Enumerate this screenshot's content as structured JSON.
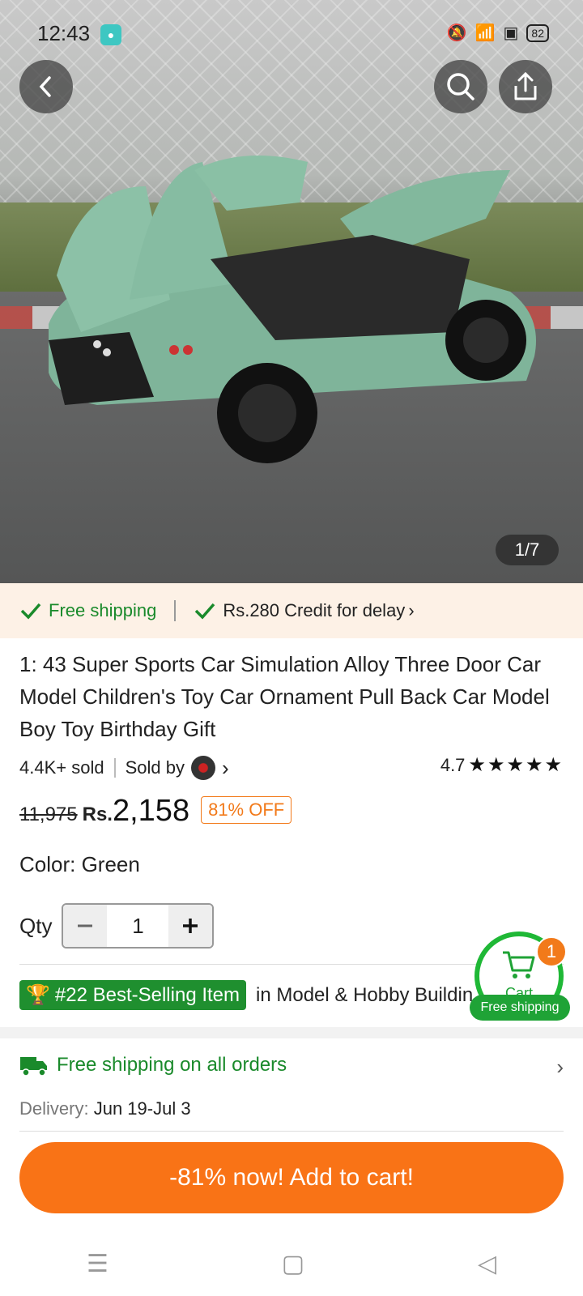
{
  "status_bar": {
    "time": "12:43",
    "battery": "82"
  },
  "hero": {
    "image_counter": "1/7"
  },
  "shipping_banner": {
    "free_shipping": "Free shipping",
    "credit": "Rs.280 Credit for delay"
  },
  "product": {
    "title": "1: 43 Super Sports Car Simulation Alloy Three Door Car Model Children's Toy Car Ornament Pull Back Car Model Boy Toy Birthday Gift",
    "sold": "4.4K+ sold",
    "sold_by": "Sold by",
    "rating": "4.7",
    "old_price": "11,975",
    "currency": "Rs.",
    "price": "2,158",
    "discount": "81% OFF",
    "color": "Color: Green",
    "qty_label": "Qty",
    "qty_value": "1"
  },
  "best_selling": {
    "badge": "#22 Best-Selling Item",
    "category": "in Model & Hobby Buildin"
  },
  "cart": {
    "label": "Cart",
    "count": "1",
    "free_shipping": "Free shipping"
  },
  "shipping_info": {
    "title": "Free shipping on all orders",
    "delivery_label": "Delivery:",
    "delivery_dates": "Jun 19-Jul 3"
  },
  "cta": {
    "label": "-81% now! Add to cart!"
  },
  "colors": {
    "accent": "#f97316",
    "green": "#1a8a2b",
    "banner_bg": "#fdf1e6"
  }
}
